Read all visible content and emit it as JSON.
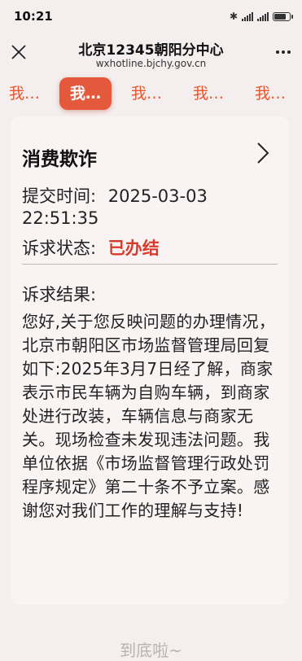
{
  "status_bar": {
    "time": "10:21",
    "battery_level": 0.85
  },
  "header": {
    "title": "北京12345朝阳分中心",
    "url": "wxhotline.bjchy.gov.cn"
  },
  "tabs": [
    {
      "label": "我…",
      "active": false
    },
    {
      "label": "我…",
      "active": true
    },
    {
      "label": "我…",
      "active": false
    },
    {
      "label": "我…",
      "active": false
    },
    {
      "label": "我…",
      "active": false
    }
  ],
  "card": {
    "title": "消费欺诈",
    "submit_label": "提交时间:",
    "submit_date": "2025-03-03",
    "submit_time": "22:51:35",
    "status_label": "诉求状态:",
    "status_value": "已办结",
    "result_heading": "诉求结果:",
    "result_body": "您好,关于您反映问题的办理情况，北京市朝阳区市场监督管理局回复如下:2025年3月7日经了解，商家表示市民车辆为自购车辆，到商家处进行改装，车辆信息与商家无关。现场检查未发现违法问题。我单位依据《市场监督管理行政处罚程序规定》第二十条不予立案。感谢您对我们工作的理解与支持!"
  },
  "footer": {
    "end_text": "到底啦~"
  },
  "colors": {
    "accent": "#e4583b",
    "status": "#d83a2b",
    "background": "#f4eeee"
  }
}
